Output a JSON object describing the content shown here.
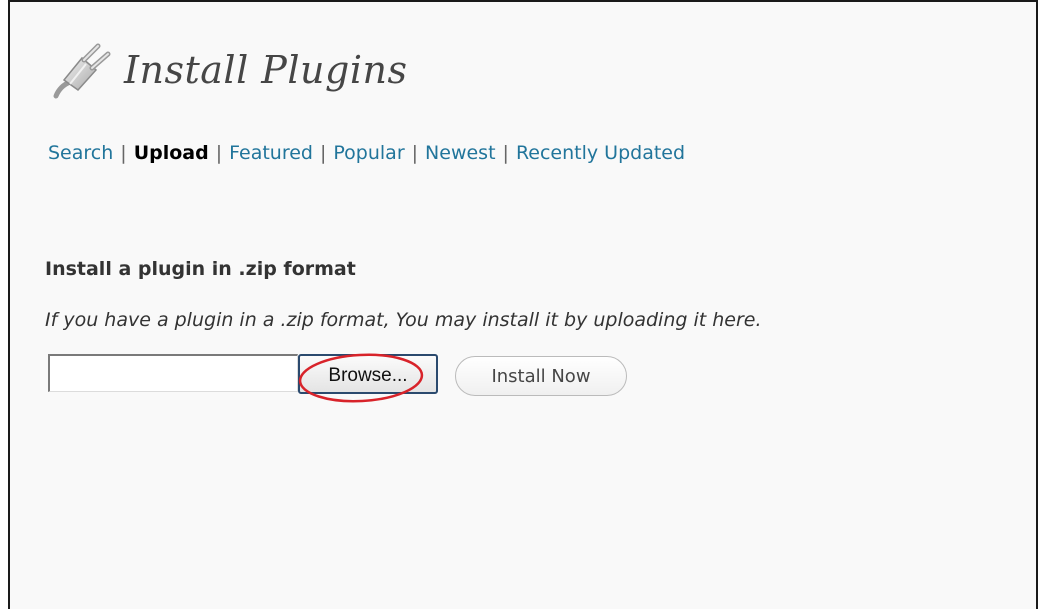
{
  "header": {
    "title": "Install Plugins",
    "icon": "plugin-plug-icon"
  },
  "subnav": {
    "items": [
      {
        "label": "Search",
        "current": false
      },
      {
        "label": "Upload",
        "current": true
      },
      {
        "label": "Featured",
        "current": false
      },
      {
        "label": "Popular",
        "current": false
      },
      {
        "label": "Newest",
        "current": false
      },
      {
        "label": "Recently Updated",
        "current": false
      }
    ],
    "separator": "|"
  },
  "upload": {
    "heading": "Install a plugin in .zip format",
    "description": "If you have a plugin in a .zip format, You may install it by uploading it here.",
    "file_value": "",
    "browse_label": "Browse...",
    "install_label": "Install Now"
  },
  "colors": {
    "link": "#21759b",
    "background": "#f9f9f9",
    "highlight": "#d8232a"
  }
}
